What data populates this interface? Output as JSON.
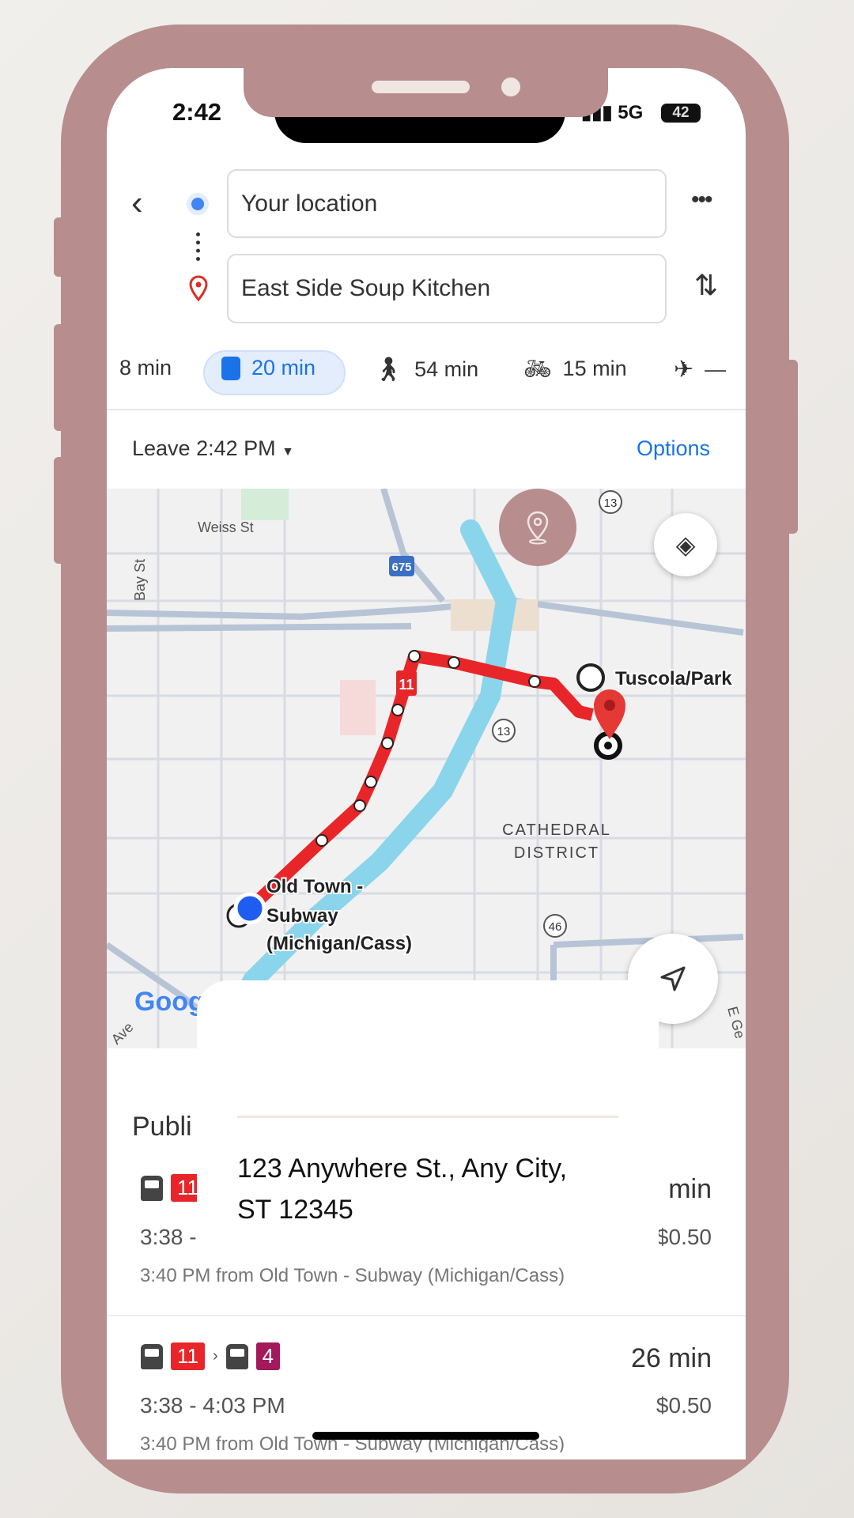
{
  "status_bar": {
    "time": "2:42",
    "network": "5G",
    "battery": "42"
  },
  "search": {
    "origin": "Your location",
    "destination": "East Side Soup Kitchen"
  },
  "modes": [
    {
      "icon": "car-icon",
      "label": "8 min"
    },
    {
      "icon": "train-icon",
      "label": "20 min",
      "selected": true
    },
    {
      "icon": "walk-icon",
      "label": "54 min"
    },
    {
      "icon": "bike-icon",
      "label": "15 min"
    },
    {
      "icon": "plane-icon",
      "label": "—"
    }
  ],
  "leave": {
    "label": "Leave 2:42 PM"
  },
  "options_label": "Options",
  "map": {
    "labels": {
      "weiss": "Weiss St",
      "bay": "Bay St",
      "i675": "675",
      "r13a": "13",
      "r13b": "13",
      "r46": "46",
      "district1": "CATHEDRAL",
      "district2": "DISTRICT",
      "tuscola": "Tuscola/Park",
      "oldtown1": "Old Town -",
      "oldtown2": "Subway",
      "oldtown3": "(Michigan/Cass)",
      "route": "11",
      "ave": "Ave",
      "ege": "E Ge",
      "google": "Goog"
    },
    "route_color": "#e8262a",
    "water_color": "#8ad4ec"
  },
  "overlay": {
    "address_line1": "123 Anywhere St., Any City,",
    "address_line2": "ST 12345"
  },
  "results": {
    "heading": "Publi",
    "routes": [
      {
        "badge1": "11",
        "duration": "min",
        "times": "3:38 -",
        "price": "$0.50",
        "from": "3:40 PM from Old Town - Subway (Michigan/Cass)"
      },
      {
        "badge1": "11",
        "badge2": "4",
        "duration": "26 min",
        "times": "3:38 - 4:03 PM",
        "price": "$0.50",
        "from": "3:40 PM from Old Town - Subway (Michigan/Cass)"
      }
    ]
  },
  "colors": {
    "frame": "#b78d8d",
    "accent": "#1a73e8",
    "badge_red": "#e8262a",
    "badge_purple": "#a3195b"
  }
}
